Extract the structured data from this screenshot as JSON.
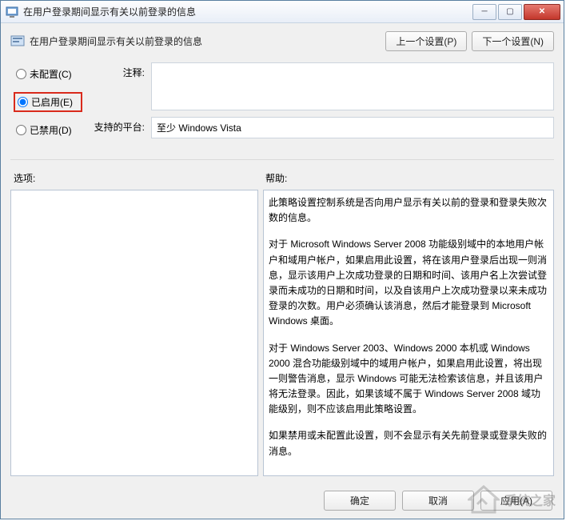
{
  "window": {
    "title": "在用户登录期间显示有关以前登录的信息"
  },
  "header": {
    "title": "在用户登录期间显示有关以前登录的信息",
    "prev_btn": "上一个设置(P)",
    "next_btn": "下一个设置(N)"
  },
  "radios": {
    "not_configured": "未配置(C)",
    "enabled": "已启用(E)",
    "disabled": "已禁用(D)",
    "selected": "enabled"
  },
  "fields": {
    "comment_label": "注释:",
    "comment_value": "",
    "platform_label": "支持的平台:",
    "platform_value": "至少 Windows Vista"
  },
  "lower": {
    "options_label": "选项:",
    "help_label": "帮助:"
  },
  "help_paragraphs": [
    "此策略设置控制系统是否向用户显示有关以前的登录和登录失败次数的信息。",
    "对于 Microsoft Windows Server 2008 功能级别域中的本地用户帐户和域用户帐户，如果启用此设置，将在该用户登录后出现一则消息，显示该用户上次成功登录的日期和时间、该用户名上次尝试登录而未成功的日期和时间，以及自该用户上次成功登录以来未成功登录的次数。用户必须确认该消息，然后才能登录到 Microsoft Windows 桌面。",
    "对于 Windows Server 2003、Windows 2000 本机或 Windows 2000 混合功能级别域中的域用户帐户，如果启用此设置，将出现一则警告消息，显示 Windows 可能无法检索该信息，并且该用户将无法登录。因此，如果该域不属于 Windows Server 2008 域功能级别，则不应该启用此策略设置。",
    "如果禁用或未配置此设置，则不会显示有关先前登录或登录失败的消息。"
  ],
  "footer": {
    "ok": "确定",
    "cancel": "取消",
    "apply": "应用(A)"
  },
  "watermark_text": "系统之家"
}
